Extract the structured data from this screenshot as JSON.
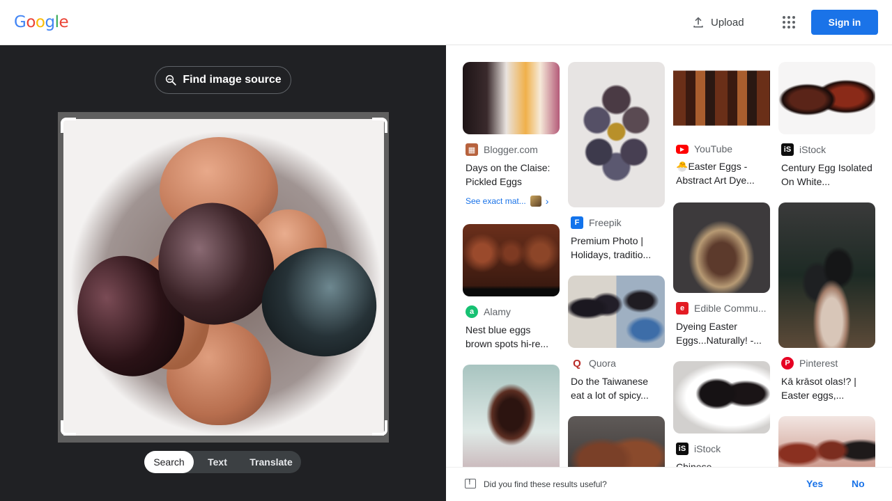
{
  "header": {
    "logo_letters": [
      "G",
      "o",
      "o",
      "g",
      "l",
      "e"
    ],
    "logo_colors": [
      "#4285f4",
      "#ea4335",
      "#fbbc05",
      "#4285f4",
      "#34a853",
      "#ea4335"
    ],
    "upload_label": "Upload",
    "upload_icon": "upload-icon",
    "apps_icon": "apps-grid-icon",
    "signin_label": "Sign in",
    "signin_color": "#1a73e8"
  },
  "lens": {
    "find_source_label": "Find image source",
    "find_source_icon": "image-search-icon",
    "modes": [
      "Search",
      "Text",
      "Translate"
    ],
    "active_mode": "Search",
    "background": "#202124"
  },
  "results": [
    {
      "source": "Blogger.com",
      "favicon": "blogger-icon",
      "title": "Days on the Claise: Pickled Eggs",
      "exact_match": "See exact mat..."
    },
    {
      "source": "Alamy",
      "favicon": "alamy-icon",
      "title": "Nest blue eggs brown spots hi-re..."
    },
    {
      "source": "Freepik",
      "favicon": "freepik-icon",
      "title": "Premium Photo | Holidays, traditio..."
    },
    {
      "source": "Quora",
      "favicon": "quora-icon",
      "title": "Do the Taiwanese eat a lot of spicy..."
    },
    {
      "source": "YouTube",
      "favicon": "youtube-icon",
      "title": "Easter Eggs - Abstract Art Dye..."
    },
    {
      "source": "Edible Commu...",
      "favicon": "edible-icon",
      "title": "Dyeing Easter Eggs...Naturally! -..."
    },
    {
      "source": "iStock",
      "favicon": "istock-icon",
      "title": "Chinese"
    },
    {
      "source": "iStock",
      "favicon": "istock-icon",
      "title": "Century Egg Isolated On White..."
    },
    {
      "source": "Pinterest",
      "favicon": "pinterest-icon",
      "title": "Kā krāsot olas!? | Easter eggs,..."
    }
  ],
  "feedback": {
    "question": "Did you find these results useful?",
    "yes": "Yes",
    "no": "No"
  }
}
